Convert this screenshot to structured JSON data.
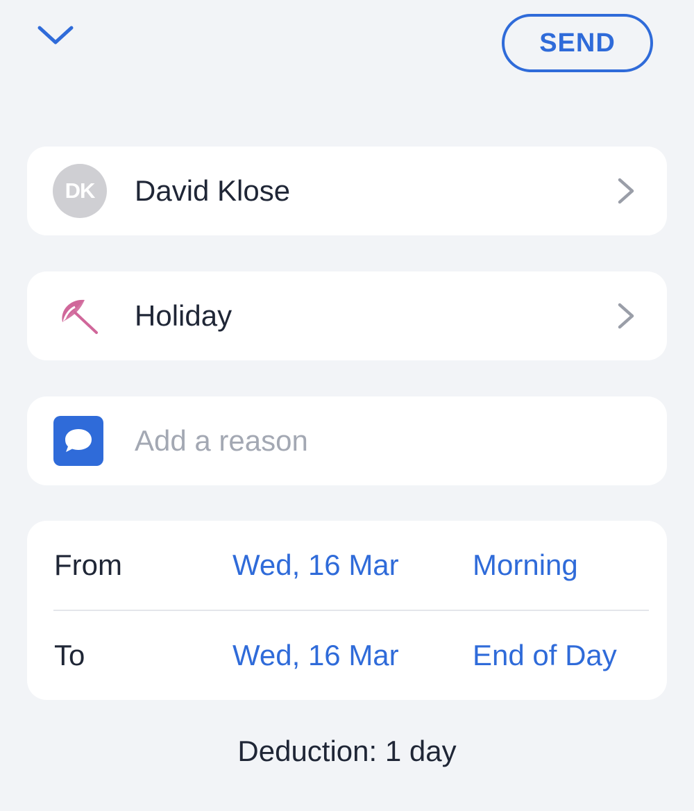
{
  "header": {
    "collapse_icon": "chevron-down-icon",
    "send_label": "SEND"
  },
  "employee": {
    "initials": "DK",
    "name": "David Klose",
    "chevron_icon": "chevron-right-icon"
  },
  "absence_type": {
    "icon": "umbrella-icon",
    "label": "Holiday",
    "icon_color": "#d0679a",
    "chevron_icon": "chevron-right-icon"
  },
  "reason": {
    "icon": "speech-bubble-icon",
    "placeholder": "Add a reason"
  },
  "dates": {
    "from": {
      "label": "From",
      "date": "Wed, 16 Mar",
      "time": "Morning"
    },
    "to": {
      "label": "To",
      "date": "Wed, 16 Mar",
      "time": "End of Day"
    }
  },
  "deduction": "Deduction: 1 day",
  "colors": {
    "accent": "#2f6bd9",
    "background": "#f2f4f7",
    "text": "#1f2636",
    "placeholder": "#a3a8b3"
  }
}
